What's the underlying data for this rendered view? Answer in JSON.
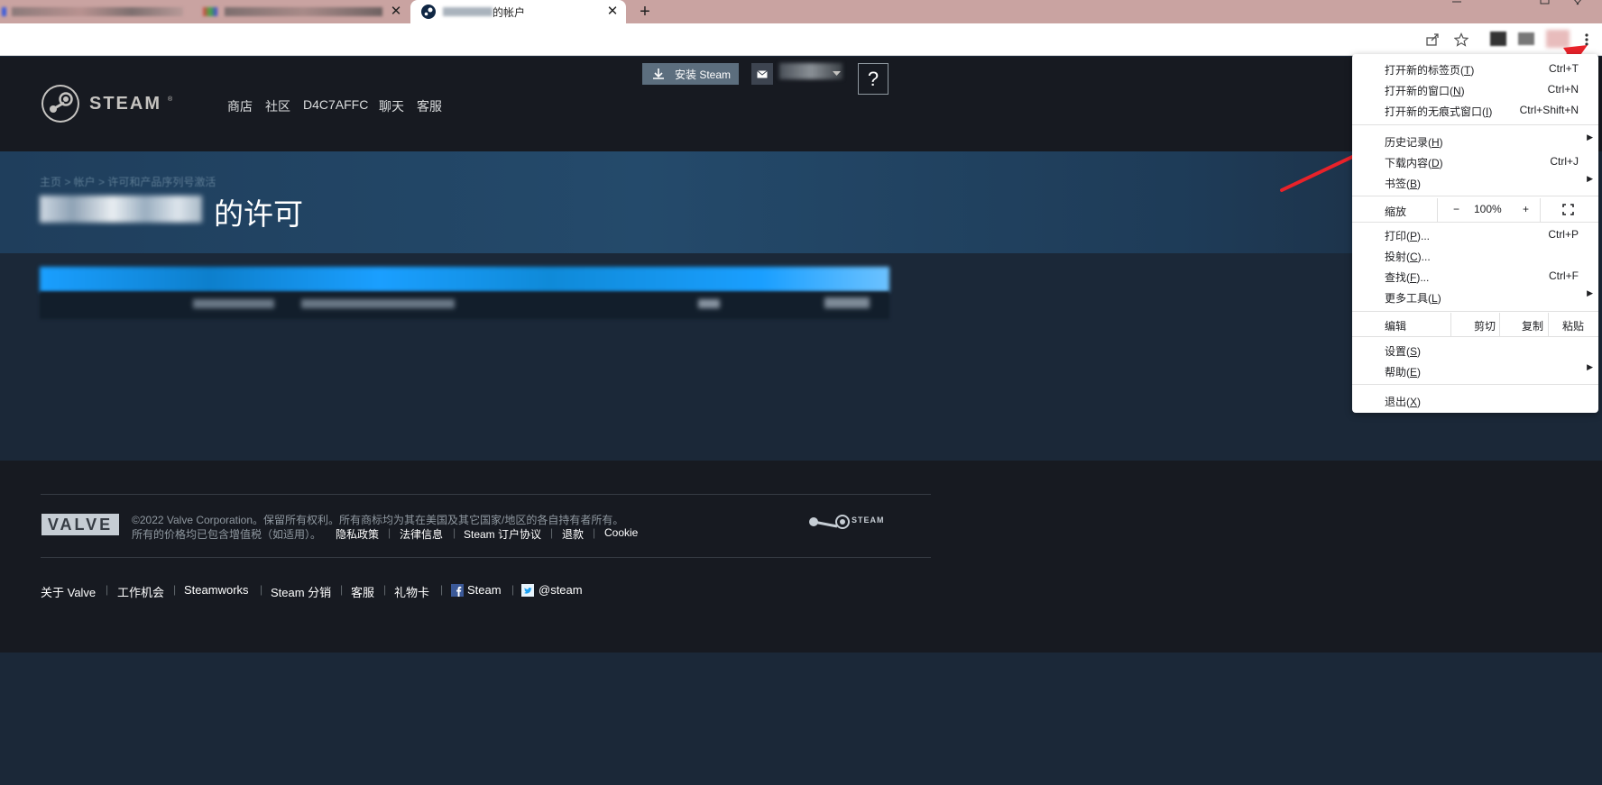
{
  "browser": {
    "tabs": [
      {
        "title": "",
        "active": false
      },
      {
        "title": "",
        "active": false
      },
      {
        "title": "的帐户",
        "active": true
      }
    ],
    "new_tab_symbol": "+",
    "close_symbol": "✕"
  },
  "steam_header": {
    "logo_text": "STEAM",
    "install_button": "安装 Steam",
    "help_symbol": "?",
    "nav": [
      "商店",
      "社区",
      "D4C7AFFC",
      "聊天",
      "客服"
    ]
  },
  "page": {
    "breadcrumb": "主页 > 帐户 > 许可和产品序列号激活",
    "title_suffix": "的许可"
  },
  "footer": {
    "valve_logo": "VALVE",
    "copyright": "©2022 Valve Corporation。保留所有权利。所有商标均为其在美国及其它国家/地区的各自持有者所有。",
    "vat_note": "所有的价格均已包含增值税（如适用）。",
    "legal_links": [
      "隐私政策",
      "法律信息",
      "Steam 订户协议",
      "退款",
      "Cookie"
    ],
    "steam_logo_text": "STEAM",
    "bottom_links": [
      "关于 Valve",
      "工作机会",
      "Steamworks",
      "Steam 分销",
      "客服",
      "礼物卡",
      "Steam",
      "@steam"
    ]
  },
  "chrome_menu": {
    "new_tab": {
      "label": "打开新的标签页(",
      "key": "T",
      "shortcut": "Ctrl+T"
    },
    "new_window": {
      "label": "打开新的窗口(",
      "key": "N",
      "shortcut": "Ctrl+N"
    },
    "incognito": {
      "label": "打开新的无痕式窗口(",
      "key": "I",
      "shortcut": "Ctrl+Shift+N"
    },
    "history": {
      "label": "历史记录(",
      "key": "H"
    },
    "downloads": {
      "label": "下载内容(",
      "key": "D",
      "shortcut": "Ctrl+J"
    },
    "bookmarks": {
      "label": "书签(",
      "key": "B"
    },
    "zoom": {
      "label": "缩放",
      "minus": "−",
      "value": "100%",
      "plus": "+"
    },
    "print": {
      "label": "打印(",
      "key": "P",
      "tail": ")...",
      "shortcut": "Ctrl+P"
    },
    "cast": {
      "label": "投射(",
      "key": "C",
      "tail": ")..."
    },
    "find": {
      "label": "查找(",
      "key": "F",
      "tail": ")...",
      "shortcut": "Ctrl+F"
    },
    "more_tools": {
      "label": "更多工具(",
      "key": "L"
    },
    "edit": {
      "label": "编辑",
      "cut": "剪切",
      "copy": "复制",
      "paste": "粘贴"
    },
    "settings": {
      "label": "设置(",
      "key": "S"
    },
    "help": {
      "label": "帮助(",
      "key": "E"
    },
    "exit": {
      "label": "退出(",
      "key": "X"
    }
  },
  "colors": {
    "steam_bg": "#1b2838",
    "steam_header": "#171a21",
    "steam_blue": "#1a9fff",
    "annotation_arrow": "#e8222a",
    "tabbar": "#c9a3a1"
  }
}
